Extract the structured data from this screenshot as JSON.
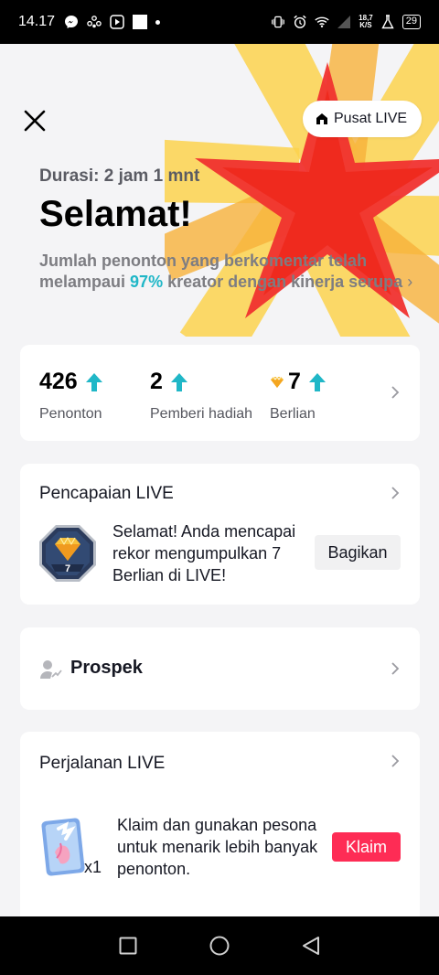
{
  "status_bar": {
    "time": "14.17",
    "net_speed_value": "18,7",
    "net_speed_unit": "K/S",
    "battery": "29"
  },
  "header": {
    "pusat_live_label": "Pusat LIVE",
    "duration": "Durasi: 2 jam 1 mnt",
    "title": "Selamat!",
    "desc_before": "Jumlah penonton yang berkomentar telah melampaui ",
    "desc_pct": "97%",
    "desc_after": " kreator dengan kinerja serupa",
    "desc_chevron": "›"
  },
  "stats": [
    {
      "value": "426",
      "label": "Penonton"
    },
    {
      "value": "2",
      "label": "Pemberi hadiah"
    },
    {
      "value": "7",
      "label": "Berlian"
    }
  ],
  "achievement": {
    "title": "Pencapaian LIVE",
    "badge_number": "7",
    "text": "Selamat! Anda mencapai rekor mengumpulkan 7 Berlian di LIVE!",
    "share_label": "Bagikan"
  },
  "prospek": {
    "label": "Prospek"
  },
  "journey": {
    "title": "Perjalanan LIVE",
    "charm_count": "x1",
    "text": "Klaim dan gunakan pesona untuk menarik lebih banyak penonton.",
    "claim_label": "Klaim"
  },
  "colors": {
    "accent_teal": "#20b7c7",
    "claim_red": "#fe2c55",
    "burst_red": "#f0322f",
    "burst_yellow": "#fbd24e"
  },
  "icons": {
    "close": "close-icon",
    "home": "home-icon",
    "arrow_up": "arrow-up-icon",
    "diamond": "diamond-icon",
    "chevron": "chevron-right-icon",
    "prospek": "user-trend-icon"
  }
}
